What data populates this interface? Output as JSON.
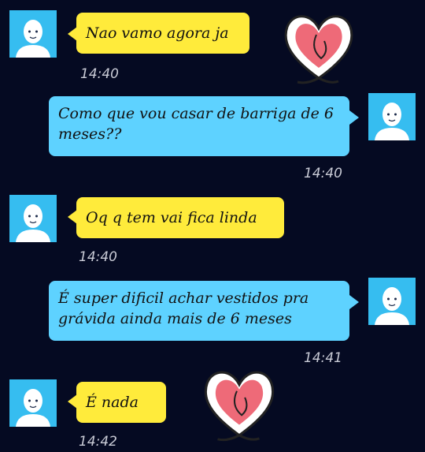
{
  "colors": {
    "background": "#050a22",
    "incoming_bubble": "#ffeb3b",
    "outgoing_bubble": "#5ed2ff",
    "avatar": "#36bdf0",
    "heart": "#ee6a78"
  },
  "messages": [
    {
      "side": "incoming",
      "text": "Nao vamo agora ja",
      "time": "14:40"
    },
    {
      "side": "outgoing",
      "text": "Como que vou casar de barriga de 6 meses??",
      "time": "14:40"
    },
    {
      "side": "incoming",
      "text": "Oq q tem vai fica linda",
      "time": "14:40"
    },
    {
      "side": "outgoing",
      "text": "É super dificil achar vestidos pra grávida ainda mais de 6 meses",
      "time": "14:41"
    },
    {
      "side": "incoming",
      "text": "É  nada",
      "time": "14:42"
    }
  ],
  "icons": {
    "avatar": "default-person-icon",
    "sticker": "heart-sticker-icon"
  }
}
